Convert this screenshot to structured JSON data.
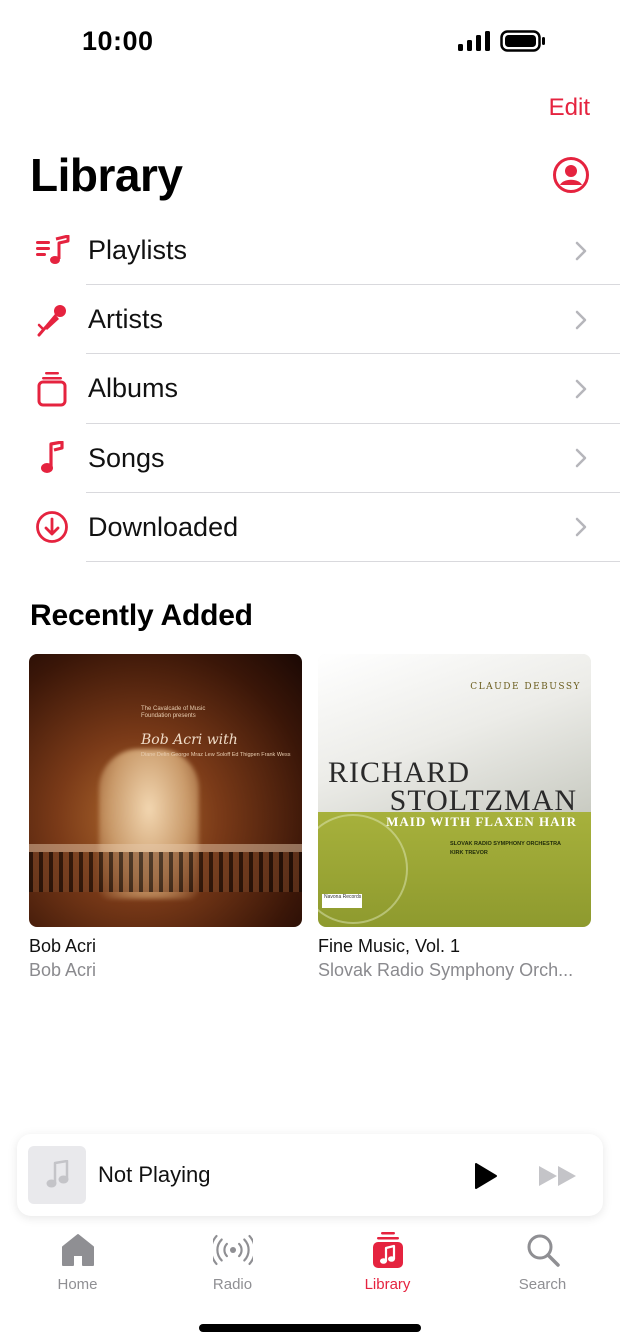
{
  "status_bar": {
    "time": "10:00"
  },
  "header": {
    "edit_label": "Edit",
    "title": "Library",
    "account_icon": "person-circle-icon"
  },
  "menu": [
    {
      "label": "Playlists",
      "icon": "playlist-icon"
    },
    {
      "label": "Artists",
      "icon": "microphone-icon"
    },
    {
      "label": "Albums",
      "icon": "album-stack-icon"
    },
    {
      "label": "Songs",
      "icon": "music-note-icon"
    },
    {
      "label": "Downloaded",
      "icon": "download-circle-icon"
    }
  ],
  "recently_added": {
    "title": "Recently Added",
    "albums": [
      {
        "title": "Bob Acri",
        "artist": "Bob Acri",
        "cover": {
          "small_text": "The Cavalcade of Music Foundation presents",
          "name_text": "Bob Acri with",
          "credits": "Diane Delin George Mraz Lew Soloff Ed Thigpen Frank Wess"
        }
      },
      {
        "title": "Fine Music, Vol. 1",
        "artist": "Slovak Radio Symphony Orch...",
        "cover": {
          "composer": "CLAUDE DEBUSSY",
          "name_line1": "RICHARD",
          "name_line2": "STOLTZMAN",
          "subtitle": "MAID WITH FLAXEN HAIR",
          "orchestra": "SLOVAK RADIO SYMPHONY ORCHESTRA",
          "conductor": "KIRK TREVOR",
          "label": "Navona Records"
        }
      }
    ]
  },
  "mini_player": {
    "title": "Not Playing"
  },
  "tab_bar": [
    {
      "label": "Home",
      "icon": "home-icon",
      "active": false
    },
    {
      "label": "Radio",
      "icon": "radio-broadcast-icon",
      "active": false
    },
    {
      "label": "Library",
      "icon": "library-icon",
      "active": true
    },
    {
      "label": "Search",
      "icon": "search-icon",
      "active": false
    }
  ],
  "colors": {
    "accent": "#e5233f",
    "secondary_text": "#8a8a8e",
    "separator": "#d9d9dd"
  }
}
